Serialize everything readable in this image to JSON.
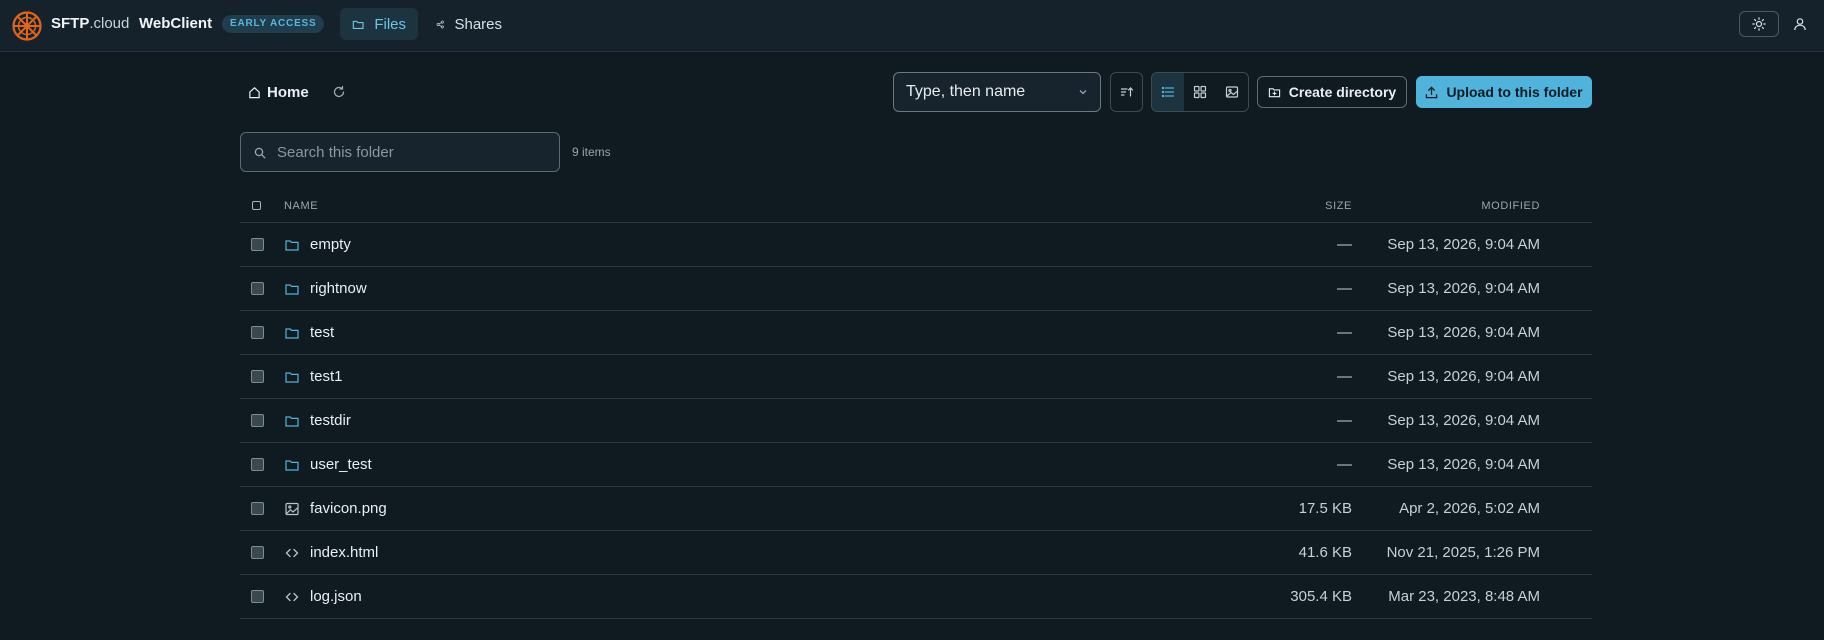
{
  "app": {
    "brand_strong": "SFTP",
    "brand_domain": ".cloud",
    "name": "WebClient",
    "badge": "EARLY ACCESS"
  },
  "nav": {
    "files": "Files",
    "shares": "Shares"
  },
  "breadcrumb": {
    "home": "Home"
  },
  "toolbar": {
    "sort_value": "Type, then name",
    "create_label": "Create directory",
    "upload_label": "Upload to this folder"
  },
  "search": {
    "placeholder": "Search this folder",
    "value": ""
  },
  "item_count": "9 items",
  "table": {
    "headers": {
      "name": "NAME",
      "size": "SIZE",
      "modified": "MODIFIED"
    },
    "rows": [
      {
        "type": "folder",
        "icon": "folder-icon",
        "name": "empty",
        "size": "—",
        "modified": "Sep 13, 2026, 9:04 AM"
      },
      {
        "type": "folder",
        "icon": "folder-icon",
        "name": "rightnow",
        "size": "—",
        "modified": "Sep 13, 2026, 9:04 AM"
      },
      {
        "type": "folder",
        "icon": "folder-icon",
        "name": "test",
        "size": "—",
        "modified": "Sep 13, 2026, 9:04 AM"
      },
      {
        "type": "folder",
        "icon": "folder-icon",
        "name": "test1",
        "size": "—",
        "modified": "Sep 13, 2026, 9:04 AM"
      },
      {
        "type": "folder",
        "icon": "folder-icon",
        "name": "testdir",
        "size": "—",
        "modified": "Sep 13, 2026, 9:04 AM"
      },
      {
        "type": "folder",
        "icon": "folder-icon",
        "name": "user_test",
        "size": "—",
        "modified": "Sep 13, 2026, 9:04 AM"
      },
      {
        "type": "image",
        "icon": "image-file-icon",
        "name": "favicon.png",
        "size": "17.5 KB",
        "modified": "Apr 2, 2026, 5:02 AM"
      },
      {
        "type": "code",
        "icon": "code-file-icon",
        "name": "index.html",
        "size": "41.6 KB",
        "modified": "Nov 21, 2025, 1:26 PM"
      },
      {
        "type": "code",
        "icon": "code-file-icon",
        "name": "log.json",
        "size": "305.4 KB",
        "modified": "Mar 23, 2023, 8:48 AM"
      }
    ]
  },
  "colors": {
    "background": "#0f1a21",
    "topbar": "#15222b",
    "accent": "#4fb3dc",
    "logo": "#e0641a"
  }
}
